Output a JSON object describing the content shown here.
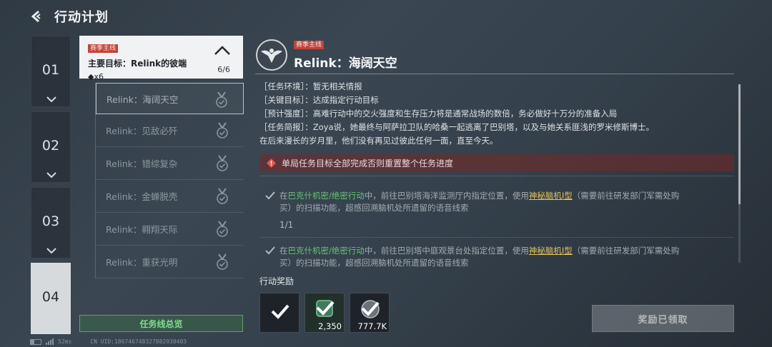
{
  "header": {
    "back_icon": "chevron-left-icon",
    "title": "行动计划"
  },
  "chapters": [
    {
      "label": "01"
    },
    {
      "label": "02"
    },
    {
      "label": "03"
    },
    {
      "label": "04"
    }
  ],
  "mission_list": {
    "main_goal": {
      "tag": "赛季主线",
      "title": "主要目标：Relink的彼端",
      "count": "◆x6",
      "progress": "6/6"
    },
    "items": [
      {
        "label": "Relink：海阔天空"
      },
      {
        "label": "Relink：见敌必歼"
      },
      {
        "label": "Relink：错综复杂"
      },
      {
        "label": "Relink：金蝉脱壳"
      },
      {
        "label": "Relink：翱翔天际"
      },
      {
        "label": "Relink：重获光明"
      }
    ],
    "overview_button": "任务线总览"
  },
  "detail": {
    "tag": "赛季主线",
    "title": "Relink：海阔天空",
    "info": [
      {
        "key": "［任务环境］",
        "value": "：暂无相关情报"
      },
      {
        "key": "［关键目标］",
        "value": "：达成指定行动目标"
      },
      {
        "key": "［预计强度］",
        "value": "：高难行动中的交火强度和生存压力将是通常战场的数倍，务必做好十万分的准备入局"
      },
      {
        "key": "［任务简报］",
        "value": "：Zoya说，她最终与阿萨拉卫队的哈桑一起逃离了巴别塔，以及与她关系匪浅的罗米修斯博士。"
      },
      {
        "key": "",
        "value": "在后来漫长的岁月里，他们没有再见过彼此任何一面，直至今天。"
      }
    ],
    "warning": "单局任务目标全部完成否则重置整个任务进度",
    "tasks": [
      {
        "prefix": "在",
        "mode": "巴克什机密/绝密行动",
        "middle": "中，前往巴别塔海洋监测厅内指定位置，使用",
        "item": "神秘脑机Ⅰ型",
        "suffix_line1": "（需要前往研发部门军需处购",
        "line2": "买）的扫描功能，超感回溯脑机处所遗留的语音线索",
        "progress": "1/1"
      },
      {
        "prefix": "在",
        "mode": "巴克什机密/绝密行动",
        "middle": "中，前往巴别塔中庭观景台处指定位置，使用",
        "item": "神秘脑机Ⅰ型",
        "suffix_line1": "（需要前往研发部门军需处购",
        "line2": "买）的扫描功能，超感回溯脑机处所遗留的语音线索",
        "progress": ""
      }
    ]
  },
  "rewards": {
    "label": "行动奖励",
    "items": [
      {
        "icon": "reward-item-icon",
        "qty": ""
      },
      {
        "icon": "reward-currency-icon",
        "qty": "2,350"
      },
      {
        "icon": "reward-coin-icon",
        "qty": "777.7K"
      }
    ],
    "claimed_button": "奖励已领取"
  },
  "status": {
    "ping": "52ms",
    "uid": "CN UID:1867467483278829304​03"
  }
}
